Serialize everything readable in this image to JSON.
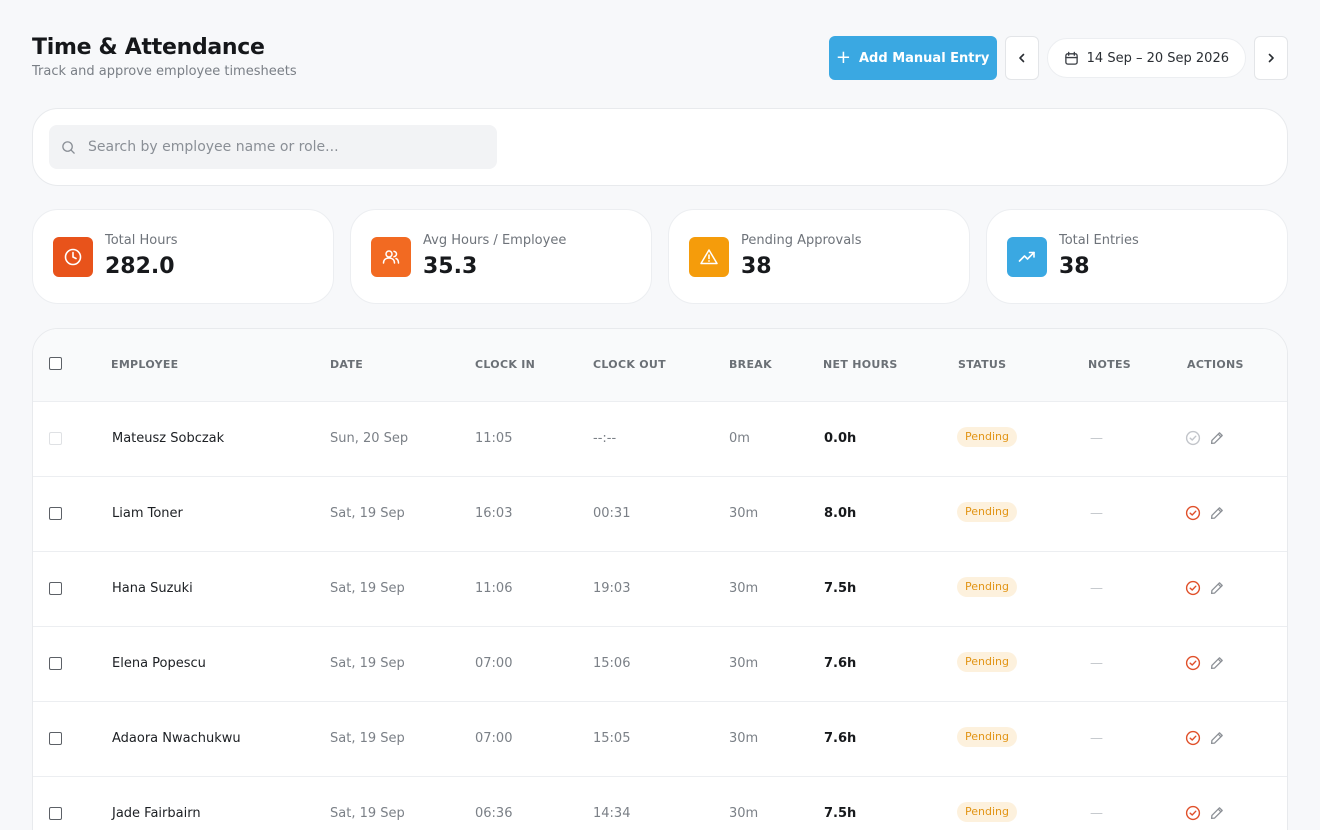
{
  "header": {
    "title": "Time & Attendance",
    "subtitle": "Track and approve employee timesheets",
    "add_button_label": "Add Manual Entry",
    "date_range": "14 Sep – 20 Sep 2026"
  },
  "search": {
    "placeholder": "Search by employee name or role..."
  },
  "stats": [
    {
      "label": "Total Hours",
      "value": "282.0",
      "icon": "clock-icon",
      "color": "#e8531b"
    },
    {
      "label": "Avg Hours / Employee",
      "value": "35.3",
      "icon": "users-icon",
      "color": "#f26a22"
    },
    {
      "label": "Pending Approvals",
      "value": "38",
      "icon": "alert-triangle-icon",
      "color": "#f59c0b"
    },
    {
      "label": "Total Entries",
      "value": "38",
      "icon": "trending-up-icon",
      "color": "#3aa8e2"
    }
  ],
  "table": {
    "columns": [
      "EMPLOYEE",
      "DATE",
      "CLOCK IN",
      "CLOCK OUT",
      "BREAK",
      "NET HOURS",
      "STATUS",
      "NOTES",
      "ACTIONS"
    ],
    "rows": [
      {
        "employee": "Mateusz Sobczak",
        "date": "Sun, 20 Sep",
        "clock_in": "11:05",
        "clock_out": "--:--",
        "break": "0m",
        "net_hours": "0.0h",
        "status": "Pending",
        "notes": "—",
        "disabled": true
      },
      {
        "employee": "Liam Toner",
        "date": "Sat, 19 Sep",
        "clock_in": "16:03",
        "clock_out": "00:31",
        "break": "30m",
        "net_hours": "8.0h",
        "status": "Pending",
        "notes": "—",
        "disabled": false
      },
      {
        "employee": "Hana Suzuki",
        "date": "Sat, 19 Sep",
        "clock_in": "11:06",
        "clock_out": "19:03",
        "break": "30m",
        "net_hours": "7.5h",
        "status": "Pending",
        "notes": "—",
        "disabled": false
      },
      {
        "employee": "Elena Popescu",
        "date": "Sat, 19 Sep",
        "clock_in": "07:00",
        "clock_out": "15:06",
        "break": "30m",
        "net_hours": "7.6h",
        "status": "Pending",
        "notes": "—",
        "disabled": false
      },
      {
        "employee": "Adaora Nwachukwu",
        "date": "Sat, 19 Sep",
        "clock_in": "07:00",
        "clock_out": "15:05",
        "break": "30m",
        "net_hours": "7.6h",
        "status": "Pending",
        "notes": "—",
        "disabled": false
      },
      {
        "employee": "Jade Fairbairn",
        "date": "Sat, 19 Sep",
        "clock_in": "06:36",
        "clock_out": "14:34",
        "break": "30m",
        "net_hours": "7.5h",
        "status": "Pending",
        "notes": "—",
        "disabled": false
      }
    ]
  },
  "colors": {
    "accent": "#3aa8e2",
    "approve_active": "#e0502a",
    "approve_disabled": "#c2c5ca",
    "pending_bg": "#fdf1dd",
    "pending_text": "#e29516"
  }
}
